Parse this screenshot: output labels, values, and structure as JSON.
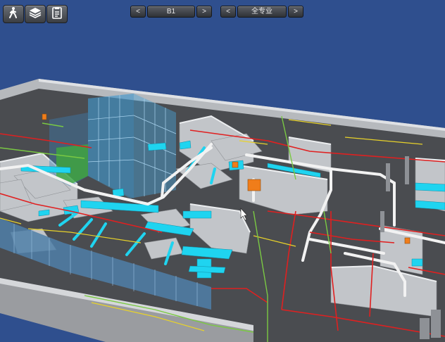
{
  "toolbar": {
    "walk_icon": "walk-icon",
    "layers_icon": "layers-icon",
    "clipboard_icon": "clipboard-icon"
  },
  "floor_nav": {
    "prev": "<",
    "label": "B1",
    "next": ">"
  },
  "discipline_nav": {
    "prev": "<",
    "label": "全专业",
    "next": ">"
  },
  "colors": {
    "background": "#2f4f8e",
    "floor": "#4a4c50",
    "wall": "#c9ccd0",
    "duct_cyan": "#1fd4f0",
    "pipe_white": "#f2f2f2",
    "pipe_red": "#e02020",
    "pipe_yellow": "#e8d22a",
    "pipe_green": "#7ac943",
    "equipment_orange": "#f07d1a",
    "glass_blue": "#4aa3d6"
  }
}
